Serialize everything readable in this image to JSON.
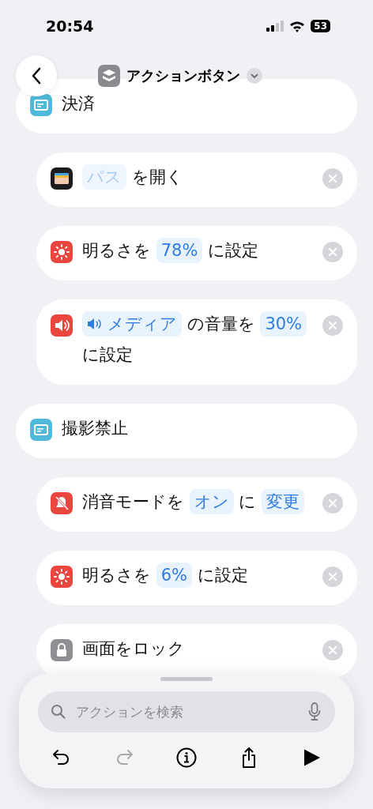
{
  "status_bar": {
    "time": "20:54",
    "battery": "53"
  },
  "nav": {
    "title": "アクションボタン"
  },
  "actions": [
    {
      "kind": "group",
      "parts": [
        {
          "kind": "text",
          "text": "決済"
        }
      ]
    },
    {
      "kind": "wallet",
      "parts": [
        {
          "kind": "token",
          "text": "パス",
          "disabled": true,
          "icon": false
        },
        {
          "kind": "text",
          "text": "を開く"
        }
      ]
    },
    {
      "kind": "brightness",
      "parts": [
        {
          "kind": "text",
          "text": "明るさを"
        },
        {
          "kind": "token",
          "text": "78%",
          "disabled": false,
          "icon": false
        },
        {
          "kind": "text",
          "text": "に設定"
        }
      ]
    },
    {
      "kind": "volume",
      "parts": [
        {
          "kind": "token",
          "text": "メディア",
          "disabled": false,
          "icon": true
        },
        {
          "kind": "text",
          "text": "の音量を"
        },
        {
          "kind": "token",
          "text": "30%",
          "disabled": false,
          "icon": false
        },
        {
          "kind": "text",
          "text": "に設定"
        }
      ]
    },
    {
      "kind": "group",
      "parts": [
        {
          "kind": "text",
          "text": "撮影禁止"
        }
      ]
    },
    {
      "kind": "silent",
      "parts": [
        {
          "kind": "text",
          "text": "消音モードを"
        },
        {
          "kind": "token",
          "text": "オン",
          "disabled": false,
          "icon": false
        },
        {
          "kind": "text",
          "text": "に"
        },
        {
          "kind": "token",
          "text": "変更",
          "disabled": false,
          "icon": false
        }
      ]
    },
    {
      "kind": "brightness",
      "parts": [
        {
          "kind": "text",
          "text": "明るさを"
        },
        {
          "kind": "token",
          "text": "6%",
          "disabled": false,
          "icon": false
        },
        {
          "kind": "text",
          "text": "に設定"
        }
      ]
    },
    {
      "kind": "lock",
      "parts": [
        {
          "kind": "text",
          "text": "画面をロック"
        }
      ]
    }
  ],
  "search": {
    "placeholder": "アクションを検索"
  },
  "toolbar": [
    {
      "kind": "undo",
      "disabled": false
    },
    {
      "kind": "redo",
      "disabled": true
    },
    {
      "kind": "info",
      "disabled": false
    },
    {
      "kind": "share",
      "disabled": false
    },
    {
      "kind": "run",
      "disabled": false
    }
  ]
}
